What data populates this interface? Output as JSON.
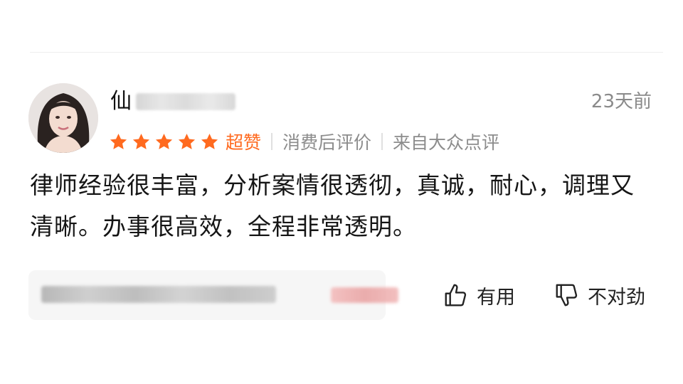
{
  "review": {
    "user": {
      "name_visible": "仙",
      "name_masked": true
    },
    "time": "23天前",
    "rating": {
      "stars": 5,
      "max": 5,
      "label": "超赞"
    },
    "tags": [
      "消费后评价",
      "来自大众点评"
    ],
    "content": "律师经验很丰富，分析案情很透彻，真诚，耐心，调理又清晰。办事很高效，全程非常透明。",
    "shop_card": {
      "masked": true
    },
    "actions": {
      "useful": "有用",
      "not_useful": "不对劲"
    }
  },
  "colors": {
    "accent": "#ff6a1f",
    "text": "#151515",
    "muted": "#8c8c8c",
    "card_bg": "#f6f6f6"
  },
  "icons": {
    "star": "star-icon",
    "thumbs_up": "thumbs-up-icon",
    "thumbs_down": "thumbs-down-icon"
  }
}
